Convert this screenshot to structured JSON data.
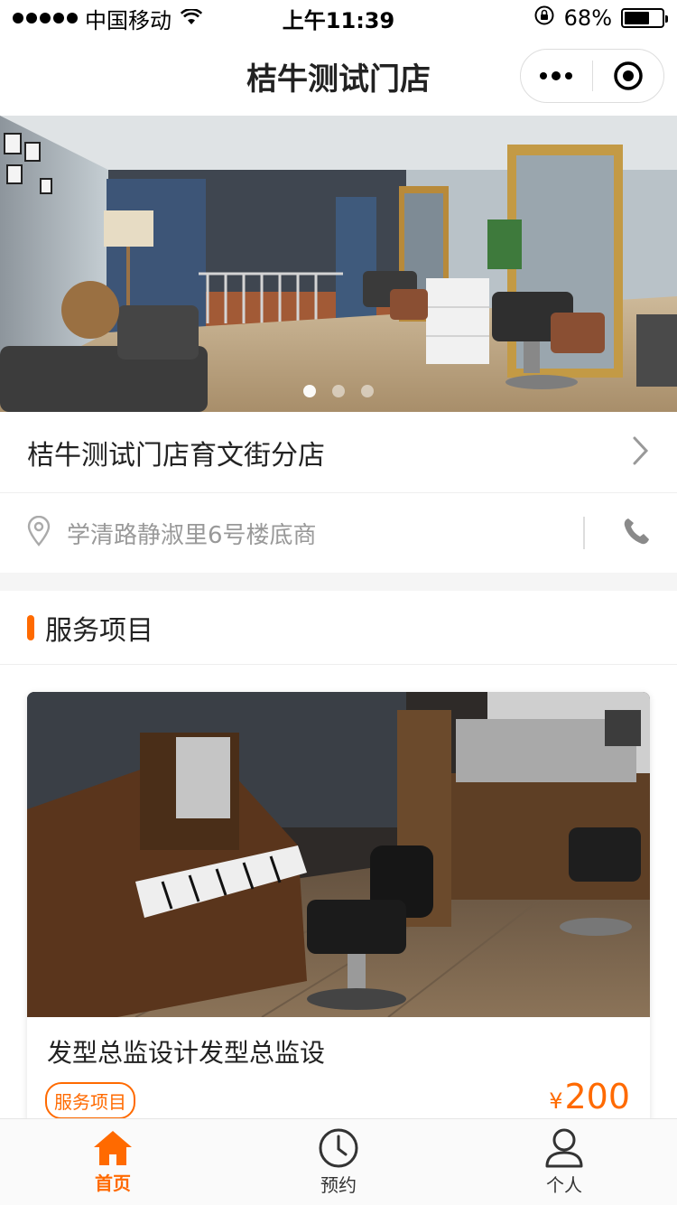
{
  "status": {
    "carrier": "中国移动",
    "time": "上午11:39",
    "battery": "68%",
    "battery_level": 0.68
  },
  "nav": {
    "title": "桔牛测试门店"
  },
  "banner": {
    "slide_count": 3,
    "active_index": 0
  },
  "store": {
    "name": "桔牛测试门店育文街分店",
    "address": "学清路静淑里6号楼底商"
  },
  "section": {
    "title": "服务项目"
  },
  "services": [
    {
      "title": "发型总监设计发型总监设",
      "tag": "服务项目",
      "currency": "¥",
      "price": "200"
    }
  ],
  "tabs": [
    {
      "label": "首页",
      "icon": "home-icon",
      "active": true
    },
    {
      "label": "预约",
      "icon": "clock-icon",
      "active": false
    },
    {
      "label": "个人",
      "icon": "user-icon",
      "active": false
    }
  ],
  "colors": {
    "accent": "#ff6a00",
    "text": "#222222",
    "muted": "#999999"
  }
}
